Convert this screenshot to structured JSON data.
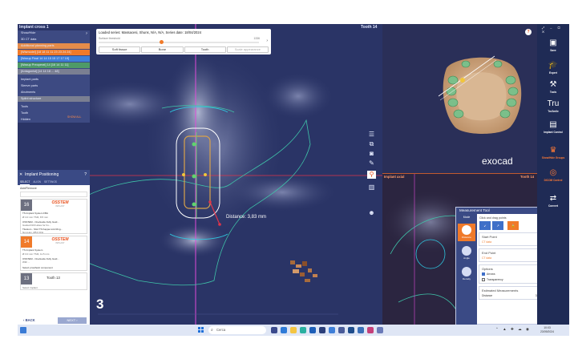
{
  "window": {
    "cross_title": "Implant cross 1",
    "tooth_title": "Tooth 14",
    "view_number": "3",
    "distance_label": "Distance: 3,83 mm"
  },
  "series_bar": {
    "loaded": "Loaded series: Massacesi, Shuns, N/A, N/A, Series date: 18/04/2024",
    "threshold_label": "Surface threshold",
    "threshold_value": "1336",
    "buttons": [
      "Soft tissue",
      "Bone",
      "Tooth",
      "Scale appearance"
    ]
  },
  "tree_panel": {
    "items": [
      {
        "label": "Show/Hide",
        "style": "plain"
      },
      {
        "label": "3D CT data",
        "style": "plain"
      },
      {
        "label": "Additional planning parts",
        "style": "orange"
      },
      {
        "label": "[Wismodel] [18 18 11 11 23 23 24 24]",
        "style": "sel"
      },
      {
        "label": "[Waxup Final 14 14 15 15 17 17 19]",
        "style": "blue"
      },
      {
        "label": "[Waxup Preoperat] 14 [16 14 11 11]",
        "style": "green"
      },
      {
        "label": "[Antagonist] [14 14 18 ... 48]",
        "style": "gray"
      },
      {
        "label": "Implant parts",
        "style": "plain"
      },
      {
        "label": "Sleeve parts",
        "style": "plain"
      },
      {
        "label": "Abutments",
        "style": "plain"
      },
      {
        "label": "Splint structure",
        "style": "gray"
      },
      {
        "label": "Tools",
        "style": "plain"
      },
      {
        "label": "Tooth",
        "style": "plain"
      },
      {
        "label": "Hidden",
        "style": "plain"
      }
    ],
    "help": "?",
    "show_all": "SHOW ALL"
  },
  "implant_panel": {
    "title": "Implant Positioning",
    "help": "?",
    "tabs": [
      "SELECT",
      "ALIGN",
      "SETTINGS"
    ],
    "add_remove": "Add/Remove",
    "cards": [
      {
        "num": "16",
        "brand": "OSSTEM",
        "brand_sub": "IMPLANT",
        "lines": [
          "TS Implant System FBA",
          "Ø 4.0 mm TSIII, 8.5 mm",
          "OSSTEM - OneGuide Fully Guid...",
          "Guided Drill Holes for Fu...",
          "Titanium - SG2 TS Kappa Link Ring...",
          "Non-Hex, Ø5.0 D/H"
        ]
      },
      {
        "num": "14",
        "brand": "OSSTEM",
        "brand_sub": "IMPLANT",
        "lines": [
          "TS Implant System",
          "Ø 3.0 mm TSIII, 11.5 mm",
          "OSSTEM - OneGuide Fully Guid...",
          "With ...",
          "Select prosthetic component"
        ]
      },
      {
        "num": "13",
        "brand": "",
        "brand_sub": "",
        "tooth": "Tooth 13",
        "lines": [
          "Select implant"
        ]
      }
    ],
    "back": "BACK",
    "next": "NEXT"
  },
  "view3d": {
    "brand": "exocad",
    "help": "?"
  },
  "axial": {
    "title": "Implant axial",
    "tooth": "Tooth 14"
  },
  "measurement": {
    "title": "Measurement Tool",
    "modes_title": "Mode",
    "modes": [
      "Distance",
      "Angle",
      "Density"
    ],
    "hint": "Click and drag points",
    "start_point": {
      "label": "Start Point",
      "value": "CT data"
    },
    "end_point": {
      "label": "End Point",
      "value": "CT data"
    },
    "options_label": "Options",
    "options": [
      {
        "label": "Arrows",
        "checked": true
      },
      {
        "label": "Transparency",
        "checked": false
      }
    ],
    "estimated_label": "Estimated Measurements",
    "distance_label": "Distance",
    "distance_value": "3,83 mm"
  },
  "right_toolbar": {
    "items": [
      "Save",
      "Expert",
      "Tools",
      "TruSmile",
      "Implant Control",
      "Show/Hide Groups",
      "DICOM Control",
      "Convert"
    ]
  },
  "taskbar": {
    "search_placeholder": "Cerca",
    "time": "10:03",
    "date": "23/09/2024"
  },
  "colors": {
    "accent": "#f07a2a",
    "panel_blue": "#3a4a85",
    "screen_bg": "#1f2b55"
  }
}
